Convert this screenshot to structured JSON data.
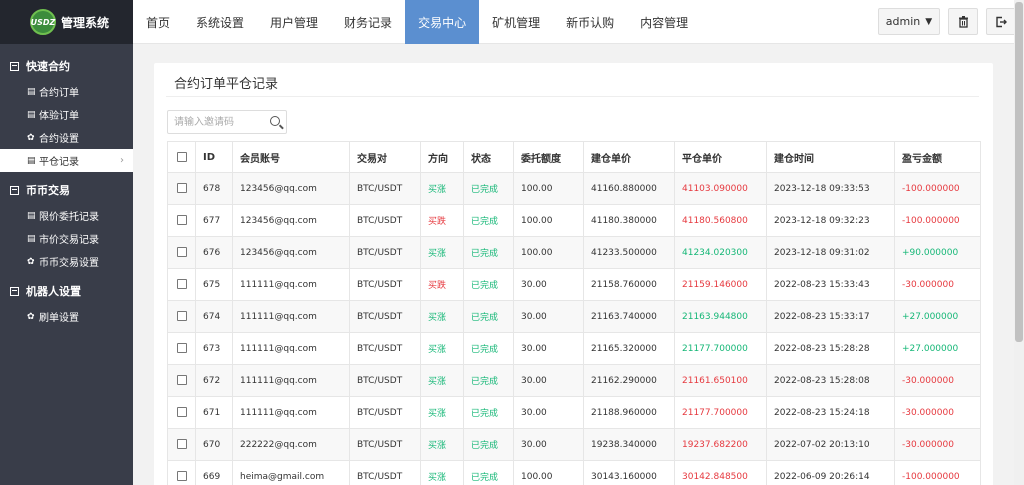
{
  "brand": {
    "logo_text": "USDZ",
    "title": "管理系统"
  },
  "sidebar": {
    "groups": [
      {
        "title": "快速合约",
        "items": [
          {
            "label": "合约订单",
            "icon": "table-icon"
          },
          {
            "label": "体验订单",
            "icon": "table-icon"
          },
          {
            "label": "合约设置",
            "icon": "gear-icon"
          },
          {
            "label": "平仓记录",
            "icon": "table-icon",
            "active": true
          }
        ]
      },
      {
        "title": "币币交易",
        "items": [
          {
            "label": "限价委托记录",
            "icon": "table-icon"
          },
          {
            "label": "市价交易记录",
            "icon": "table-icon"
          },
          {
            "label": "币币交易设置",
            "icon": "gear-icon"
          }
        ]
      },
      {
        "title": "机器人设置",
        "items": [
          {
            "label": "刷单设置",
            "icon": "gear-icon"
          }
        ]
      }
    ]
  },
  "topnav": {
    "items": [
      "首页",
      "系统设置",
      "用户管理",
      "财务记录",
      "交易中心",
      "矿机管理",
      "新币认购",
      "内容管理"
    ],
    "active_index": 4,
    "user_label": "admin"
  },
  "page": {
    "title": "合约订单平仓记录",
    "search_placeholder": "请输入邀请码"
  },
  "table": {
    "columns": [
      "ID",
      "会员账号",
      "交易对",
      "方向",
      "状态",
      "委托额度",
      "建仓单价",
      "平仓单价",
      "建仓时间",
      "盈亏金额"
    ],
    "rows": [
      {
        "id": "678",
        "account": "123456@qq.com",
        "pair": "BTC/USDT",
        "direction": "买涨",
        "dir_type": "buy",
        "status": "已完成",
        "amount": "100.00",
        "open_price": "41160.880000",
        "close_price": "41103.090000",
        "close_type": "red",
        "time": "2023-12-18 09:33:53",
        "pnl": "-100.000000",
        "pnl_type": "red"
      },
      {
        "id": "677",
        "account": "123456@qq.com",
        "pair": "BTC/USDT",
        "direction": "买跌",
        "dir_type": "sell",
        "status": "已完成",
        "amount": "100.00",
        "open_price": "41180.380000",
        "close_price": "41180.560800",
        "close_type": "red",
        "time": "2023-12-18 09:32:23",
        "pnl": "-100.000000",
        "pnl_type": "red"
      },
      {
        "id": "676",
        "account": "123456@qq.com",
        "pair": "BTC/USDT",
        "direction": "买涨",
        "dir_type": "buy",
        "status": "已完成",
        "amount": "100.00",
        "open_price": "41233.500000",
        "close_price": "41234.020300",
        "close_type": "green",
        "time": "2023-12-18 09:31:02",
        "pnl": "+90.000000",
        "pnl_type": "green"
      },
      {
        "id": "675",
        "account": "111111@qq.com",
        "pair": "BTC/USDT",
        "direction": "买跌",
        "dir_type": "sell",
        "status": "已完成",
        "amount": "30.00",
        "open_price": "21158.760000",
        "close_price": "21159.146000",
        "close_type": "red",
        "time": "2022-08-23 15:33:43",
        "pnl": "-30.000000",
        "pnl_type": "red"
      },
      {
        "id": "674",
        "account": "111111@qq.com",
        "pair": "BTC/USDT",
        "direction": "买涨",
        "dir_type": "buy",
        "status": "已完成",
        "amount": "30.00",
        "open_price": "21163.740000",
        "close_price": "21163.944800",
        "close_type": "green",
        "time": "2022-08-23 15:33:17",
        "pnl": "+27.000000",
        "pnl_type": "green"
      },
      {
        "id": "673",
        "account": "111111@qq.com",
        "pair": "BTC/USDT",
        "direction": "买涨",
        "dir_type": "buy",
        "status": "已完成",
        "amount": "30.00",
        "open_price": "21165.320000",
        "close_price": "21177.700000",
        "close_type": "green",
        "time": "2022-08-23 15:28:28",
        "pnl": "+27.000000",
        "pnl_type": "green"
      },
      {
        "id": "672",
        "account": "111111@qq.com",
        "pair": "BTC/USDT",
        "direction": "买涨",
        "dir_type": "buy",
        "status": "已完成",
        "amount": "30.00",
        "open_price": "21162.290000",
        "close_price": "21161.650100",
        "close_type": "red",
        "time": "2022-08-23 15:28:08",
        "pnl": "-30.000000",
        "pnl_type": "red"
      },
      {
        "id": "671",
        "account": "111111@qq.com",
        "pair": "BTC/USDT",
        "direction": "买涨",
        "dir_type": "buy",
        "status": "已完成",
        "amount": "30.00",
        "open_price": "21188.960000",
        "close_price": "21177.700000",
        "close_type": "red",
        "time": "2022-08-23 15:24:18",
        "pnl": "-30.000000",
        "pnl_type": "red"
      },
      {
        "id": "670",
        "account": "222222@qq.com",
        "pair": "BTC/USDT",
        "direction": "买涨",
        "dir_type": "buy",
        "status": "已完成",
        "amount": "30.00",
        "open_price": "19238.340000",
        "close_price": "19237.682200",
        "close_type": "red",
        "time": "2022-07-02 20:13:10",
        "pnl": "-30.000000",
        "pnl_type": "red"
      },
      {
        "id": "669",
        "account": "heima@gmail.com",
        "pair": "BTC/USDT",
        "direction": "买涨",
        "dir_type": "buy",
        "status": "已完成",
        "amount": "100.00",
        "open_price": "30143.160000",
        "close_price": "30142.848500",
        "close_type": "red",
        "time": "2022-06-09 20:26:14",
        "pnl": "-100.000000",
        "pnl_type": "red"
      }
    ]
  },
  "colors": {
    "sidebar_bg": "#393d49",
    "brand_bg": "#23262e",
    "nav_active": "#5b8fd0",
    "buy_green": "#16b777",
    "loss_red": "#e6393f"
  }
}
